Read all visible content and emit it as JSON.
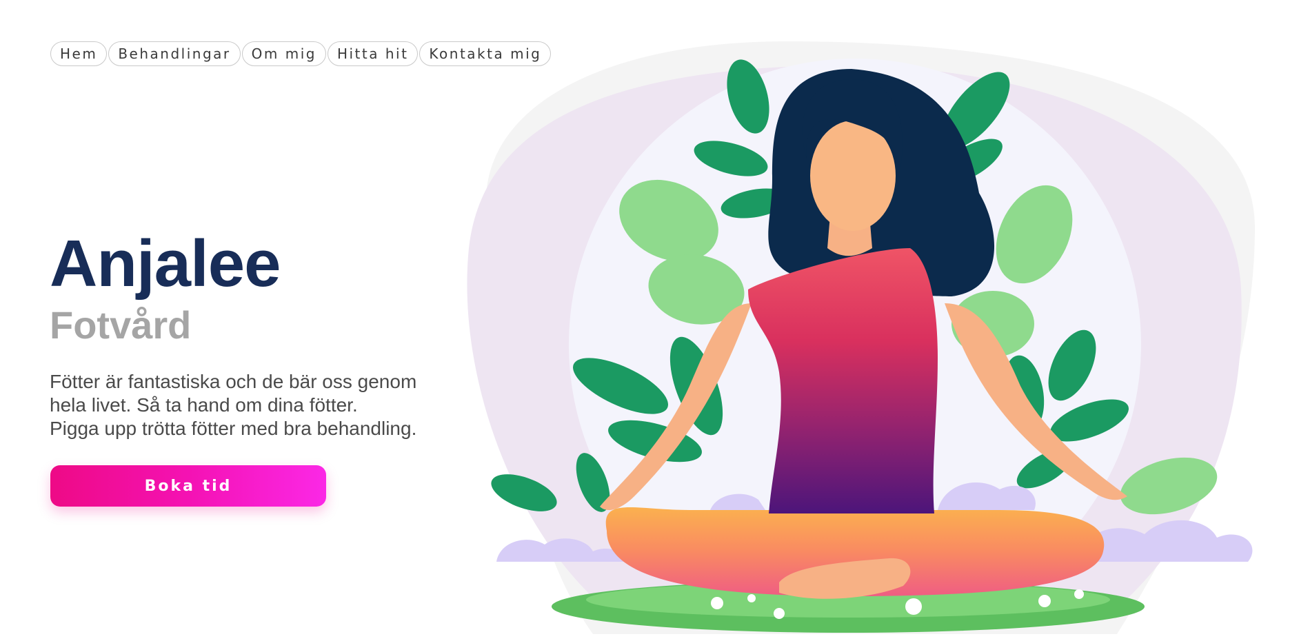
{
  "nav": {
    "items": [
      {
        "label": "Hem"
      },
      {
        "label": "Behandlingar"
      },
      {
        "label": "Om mig"
      },
      {
        "label": "Hitta hit"
      },
      {
        "label": "Kontakta mig"
      }
    ]
  },
  "hero": {
    "title": "Anjalee",
    "subtitle": "Fotvård",
    "description_lines": [
      "Fötter är fantastiska och de bär oss genom",
      "hela livet. Så ta hand om dina fötter.",
      "Pigga upp trötta fötter med bra behandling."
    ],
    "cta_label": "Boka tid"
  },
  "colors": {
    "title": "#182d58",
    "subtitle": "#a5a5a5",
    "cta_gradient_start": "#ee0a86",
    "cta_gradient_end": "#fb28e6"
  },
  "illustration": {
    "name": "meditating-woman-illustration"
  }
}
